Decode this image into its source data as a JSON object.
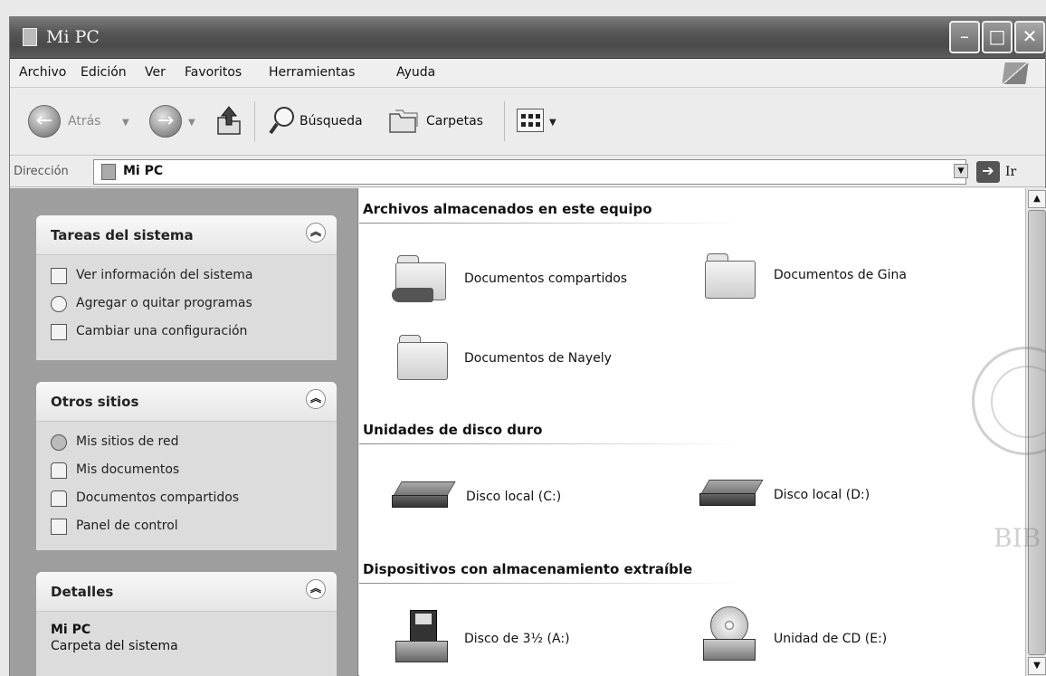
{
  "window": {
    "title": "Mi PC"
  },
  "menu": [
    "Archivo",
    "Edición",
    "Ver",
    "Favoritos",
    "Herramientas",
    "Ayuda"
  ],
  "toolbar": {
    "back_label": "Atrás",
    "search_label": "Búsqueda",
    "folders_label": "Carpetas"
  },
  "address": {
    "label": "Dirección",
    "value": "Mi PC",
    "go_label": "Ir"
  },
  "left_pane": {
    "system_tasks": {
      "title": "Tareas del sistema",
      "items": [
        "Ver información del sistema",
        "Agregar o quitar programas",
        "Cambiar una configuración"
      ]
    },
    "other_places": {
      "title": "Otros sitios",
      "items": [
        "Mis sitios de red",
        "Mis documentos",
        "Documentos compartidos",
        "Panel de control"
      ]
    },
    "details": {
      "title": "Detalles",
      "name": "Mi PC",
      "description": "Carpeta del sistema"
    }
  },
  "content": {
    "sections": [
      {
        "title": "Archivos almacenados en este equipo",
        "items": [
          "Documentos compartidos",
          "Documentos de Gina",
          "Documentos de Nayely"
        ]
      },
      {
        "title": "Unidades de disco duro",
        "items": [
          "Disco local (C:)",
          "Disco local (D:)"
        ]
      },
      {
        "title": "Dispositivos con almacenamiento extraíble",
        "items": [
          "Disco de 3½ (A:)",
          "Unidad de CD (E:)"
        ]
      }
    ]
  },
  "icons": {
    "window": "computer-icon",
    "back": "back-arrow-icon",
    "forward": "forward-arrow-icon",
    "up": "folder-up-icon",
    "search": "magnifier-icon",
    "folders": "folders-icon",
    "views": "view-grid-icon",
    "go": "go-arrow-icon"
  },
  "watermark": {
    "stamp_text": "BIB"
  }
}
